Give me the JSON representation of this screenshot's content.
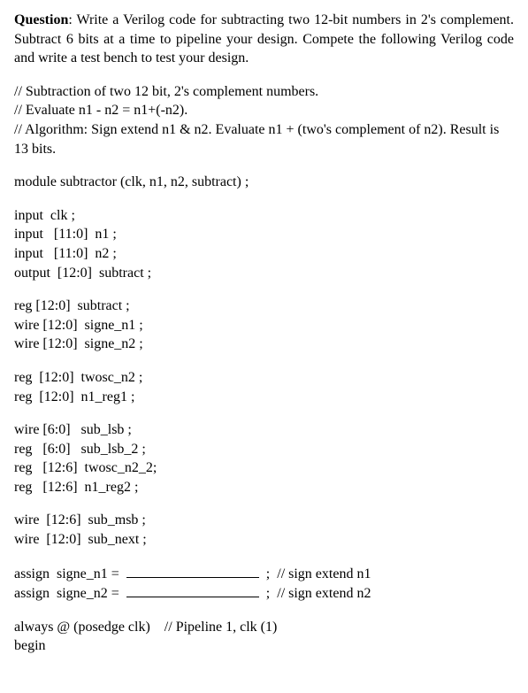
{
  "question": {
    "label": "Question",
    "text": ": Write a Verilog code for subtracting two 12-bit numbers in 2's complement. Subtract 6 bits at a time to pipeline your design. Compete the following Verilog code and write a test bench to test your design."
  },
  "comments": {
    "line1": "// Subtraction of two 12 bit, 2's complement numbers.",
    "line2": "// Evaluate n1 - n2 = n1+(-n2).",
    "line3": "// Algorithm: Sign extend n1 & n2. Evaluate n1 + (two's complement of n2). Result is 13 bits."
  },
  "module_decl": "module subtractor (clk, n1, n2, subtract) ;",
  "ports": {
    "clk": "input  clk ;",
    "n1": "input   [11:0]  n1 ;",
    "n2": "input   [11:0]  n2 ;",
    "subtract": "output  [12:0]  subtract ;"
  },
  "decls1": {
    "subtract": "reg [12:0]  subtract ;",
    "signe_n1": "wire [12:0]  signe_n1 ;",
    "signe_n2": "wire [12:0]  signe_n2 ;"
  },
  "decls2": {
    "twosc_n2": "reg  [12:0]  twosc_n2 ;",
    "n1_reg1": "reg  [12:0]  n1_reg1 ;"
  },
  "decls3": {
    "sub_lsb": "wire [6:0]   sub_lsb ;",
    "sub_lsb_2": "reg   [6:0]   sub_lsb_2 ;",
    "twosc_n2_2": "reg   [12:6]  twosc_n2_2;",
    "n1_reg2": "reg   [12:6]  n1_reg2 ;"
  },
  "decls4": {
    "sub_msb": "wire  [12:6]  sub_msb ;",
    "sub_next": "wire  [12:0]  sub_next ;"
  },
  "assigns": {
    "signe_n1_prefix": "assign  signe_n1 = ",
    "signe_n1_suffix": " ;  // sign extend n1",
    "signe_n2_prefix": "assign  signe_n2 = ",
    "signe_n2_suffix": " ;  // sign extend n2"
  },
  "always_block": {
    "line1": "always @ (posedge clk)    // Pipeline 1, clk (1)",
    "line2": "begin"
  }
}
